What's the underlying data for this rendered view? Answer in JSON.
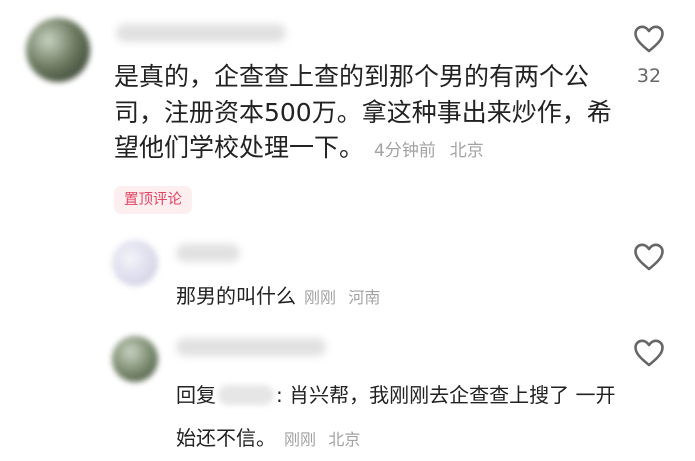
{
  "main_comment": {
    "text": "是真的，企查查上查的到那个男的有两个公司，注册资本500万。拿这种事出来炒作，希望他们学校处理一下。",
    "time": "4分钟前",
    "location": "北京",
    "like_count": "32",
    "badge": "置顶评论"
  },
  "replies": [
    {
      "text": "那男的叫什么",
      "time": "刚刚",
      "location": "河南"
    },
    {
      "reply_prefix": "回复",
      "reply_separator": ":",
      "text": "肖兴帮，我刚刚去企查查上搜了 一开始还不信。",
      "time": "刚刚",
      "location": "北京"
    }
  ],
  "icons": {
    "like": "heart-outline-icon"
  },
  "colors": {
    "badge_text": "#e44461",
    "badge_bg": "#fdeef0",
    "meta_text": "#a3a3a3"
  }
}
